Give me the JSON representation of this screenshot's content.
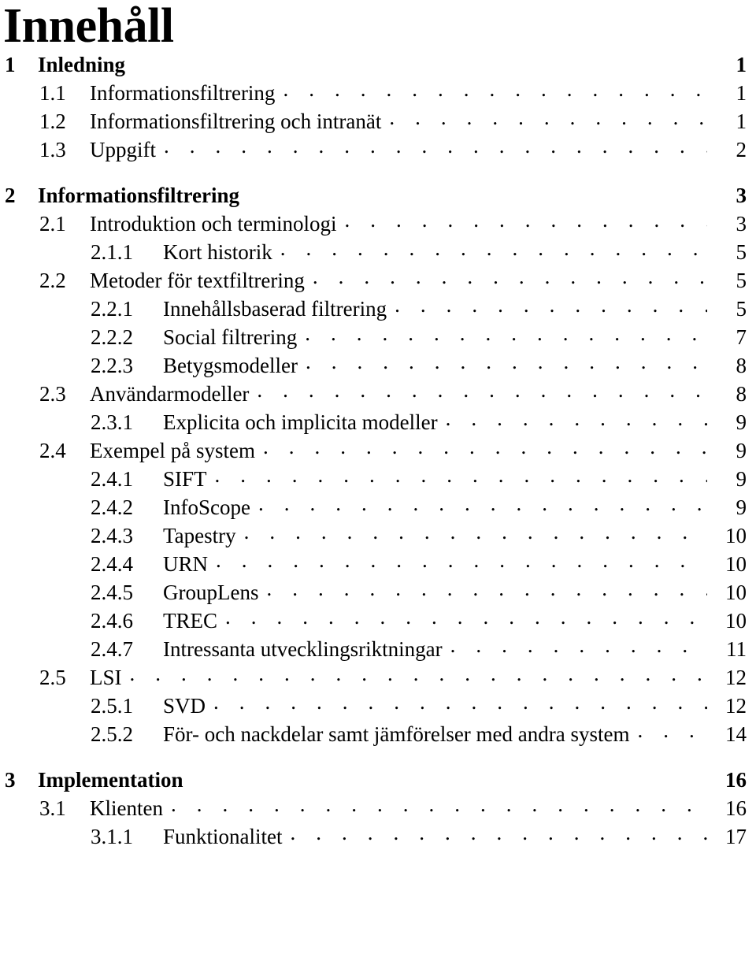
{
  "document": {
    "title": "Innehåll",
    "language": "sv"
  },
  "toc": {
    "entries": [
      {
        "level": "chapter",
        "number": "1",
        "label": "Inledning",
        "page": "1"
      },
      {
        "level": "section",
        "number": "1.1",
        "label": "Informationsfiltrering",
        "page": "1"
      },
      {
        "level": "section",
        "number": "1.2",
        "label": "Informationsfiltrering och intranät",
        "page": "1"
      },
      {
        "level": "section",
        "number": "1.3",
        "label": "Uppgift",
        "page": "2"
      },
      {
        "level": "chapter",
        "number": "2",
        "label": "Informationsfiltrering",
        "page": "3"
      },
      {
        "level": "section",
        "number": "2.1",
        "label": "Introduktion och terminologi",
        "page": "3"
      },
      {
        "level": "subsection",
        "number": "2.1.1",
        "label": "Kort historik",
        "page": "5"
      },
      {
        "level": "section",
        "number": "2.2",
        "label": "Metoder för textfiltrering",
        "page": "5"
      },
      {
        "level": "subsection",
        "number": "2.2.1",
        "label": "Innehållsbaserad filtrering",
        "page": "5"
      },
      {
        "level": "subsection",
        "number": "2.2.2",
        "label": "Social filtrering",
        "page": "7"
      },
      {
        "level": "subsection",
        "number": "2.2.3",
        "label": "Betygsmodeller",
        "page": "8"
      },
      {
        "level": "section",
        "number": "2.3",
        "label": "Användarmodeller",
        "page": "8"
      },
      {
        "level": "subsection",
        "number": "2.3.1",
        "label": "Explicita och implicita modeller",
        "page": "9"
      },
      {
        "level": "section",
        "number": "2.4",
        "label": "Exempel på system",
        "page": "9"
      },
      {
        "level": "subsection",
        "number": "2.4.1",
        "label": "SIFT",
        "page": "9"
      },
      {
        "level": "subsection",
        "number": "2.4.2",
        "label": "InfoScope",
        "page": "9"
      },
      {
        "level": "subsection",
        "number": "2.4.3",
        "label": "Tapestry",
        "page": "10"
      },
      {
        "level": "subsection",
        "number": "2.4.4",
        "label": "URN",
        "page": "10"
      },
      {
        "level": "subsection",
        "number": "2.4.5",
        "label": "GroupLens",
        "page": "10"
      },
      {
        "level": "subsection",
        "number": "2.4.6",
        "label": "TREC",
        "page": "10"
      },
      {
        "level": "subsection",
        "number": "2.4.7",
        "label": "Intressanta utvecklingsriktningar",
        "page": "11"
      },
      {
        "level": "section",
        "number": "2.5",
        "label": "LSI",
        "page": "12"
      },
      {
        "level": "subsection",
        "number": "2.5.1",
        "label": "SVD",
        "page": "12"
      },
      {
        "level": "subsection",
        "number": "2.5.2",
        "label": "För- och nackdelar samt jämförelser med andra system",
        "page": "14"
      },
      {
        "level": "chapter",
        "number": "3",
        "label": "Implementation",
        "page": "16"
      },
      {
        "level": "section",
        "number": "3.1",
        "label": "Klienten",
        "page": "16"
      },
      {
        "level": "subsection",
        "number": "3.1.1",
        "label": "Funktionalitet",
        "page": "17"
      }
    ]
  }
}
